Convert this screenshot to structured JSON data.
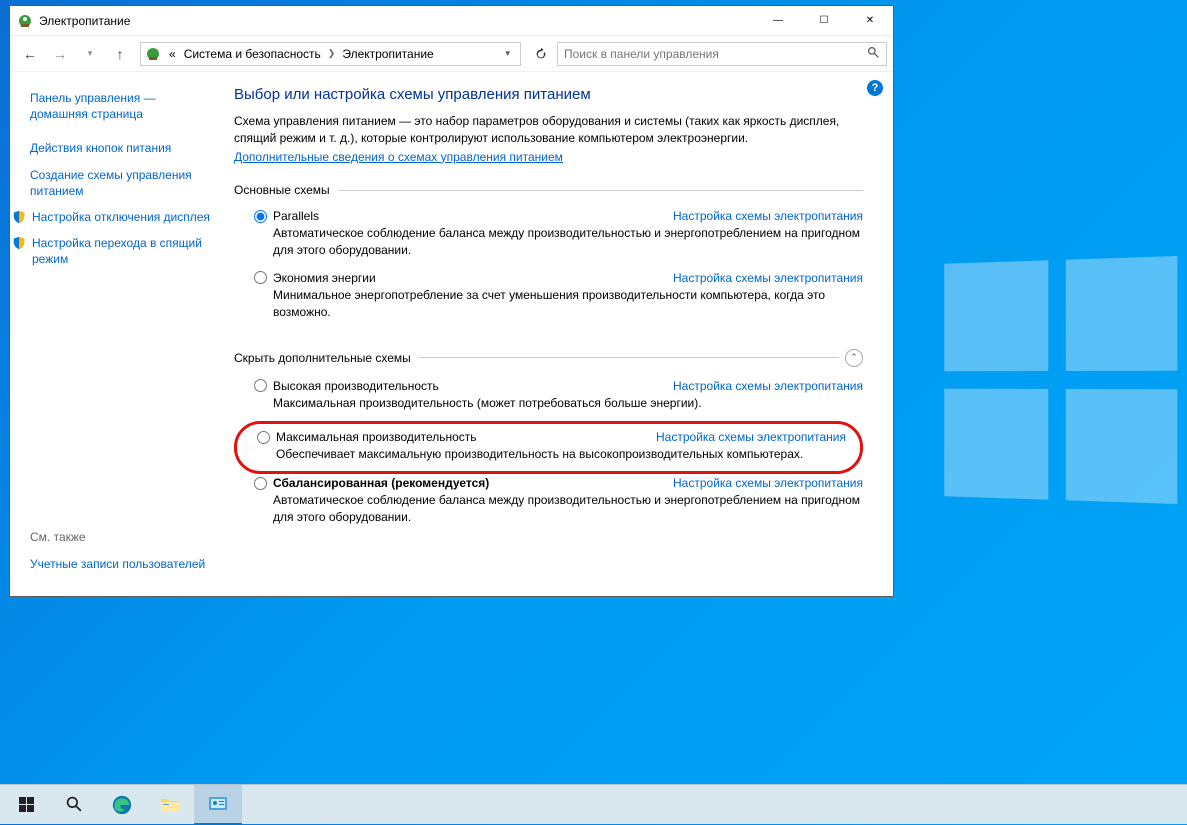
{
  "window": {
    "title": "Электропитание",
    "controls": {
      "min": "—",
      "max": "☐",
      "close": "✕"
    }
  },
  "nav": {
    "breadcrumb": {
      "prefix": "«",
      "seg1": "Система и безопасность",
      "seg2": "Электропитание"
    },
    "search_placeholder": "Поиск в панели управления"
  },
  "sidebar": {
    "home": "Панель управления — домашняя страница",
    "links": [
      "Действия кнопок питания",
      "Создание схемы управления питанием",
      "Настройка отключения дисплея",
      "Настройка перехода в спящий режим"
    ],
    "see_also_hdr": "См. также",
    "see_also_link": "Учетные записи пользователей"
  },
  "content": {
    "title": "Выбор или настройка схемы управления питанием",
    "intro": "Схема управления питанием — это набор параметров оборудования и системы (таких как яркость дисплея, спящий режим и т. д.), которые контролируют использование компьютером электроэнергии.",
    "intro_link": "Дополнительные сведения о схемах управления питанием",
    "section1": "Основные схемы",
    "section2": "Скрыть дополнительные схемы",
    "change_link": "Настройка схемы электропитания",
    "plans": [
      {
        "name": "Parallels",
        "desc": "Автоматическое соблюдение баланса между производительностью и энергопотреблением на пригодном для этого оборудовании.",
        "checked": true
      },
      {
        "name": "Экономия энергии",
        "desc": "Минимальное энергопотребление за счет уменьшения производительности компьютера, когда это возможно.",
        "checked": false
      },
      {
        "name": "Высокая производительность",
        "desc": "Максимальная производительность (может потребоваться больше энергии).",
        "checked": false
      },
      {
        "name": "Максимальная производительность",
        "desc": "Обеспечивает максимальную производительность на высокопроизводительных компьютерах.",
        "checked": false,
        "highlighted": true
      },
      {
        "name": "Сбалансированная (рекомендуется)",
        "desc": "Автоматическое соблюдение баланса между производительностью и энергопотреблением на пригодном для этого оборудовании.",
        "checked": false,
        "bold": true
      }
    ]
  }
}
